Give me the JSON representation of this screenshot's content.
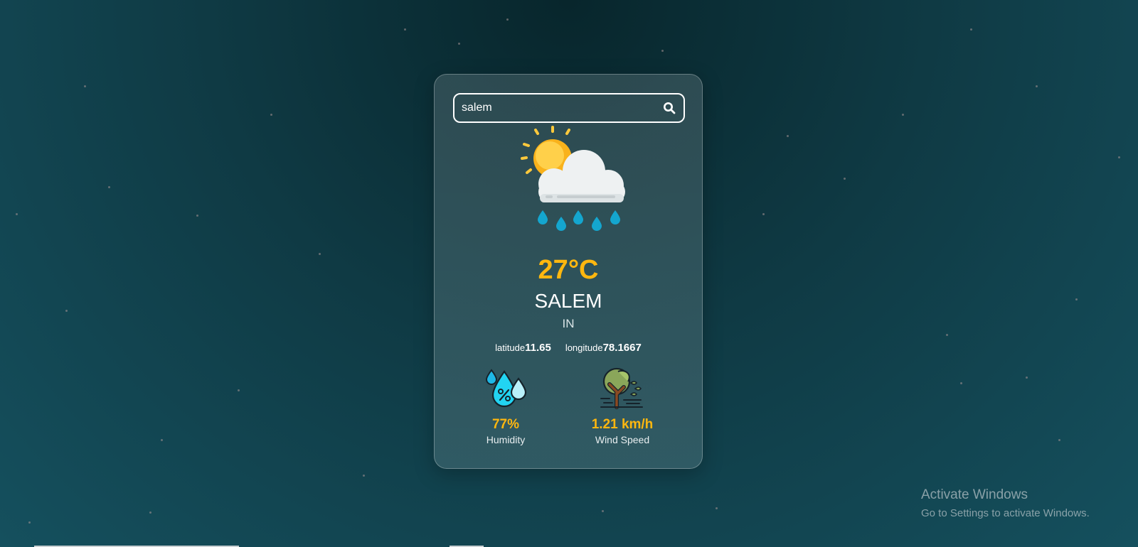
{
  "search": {
    "value": "salem",
    "icon": "search-icon"
  },
  "weather": {
    "icon": "sun-cloud-rain-icon",
    "temperature": "27°C",
    "city": "SALEM",
    "country": "IN",
    "latitude_label": "latitude",
    "latitude_value": "11.65",
    "longitude_label": "longitude",
    "longitude_value": "78.1667"
  },
  "stats": {
    "humidity": {
      "icon": "humidity-drops-icon",
      "value": "77%",
      "label": "Humidity"
    },
    "wind": {
      "icon": "windy-tree-icon",
      "value": "1.21 km/h",
      "label": "Wind Speed"
    }
  },
  "watermark": {
    "title": "Activate Windows",
    "subtitle": "Go to Settings to activate Windows."
  },
  "colors": {
    "accent": "#ffb70f",
    "background": "#0f3a44"
  }
}
